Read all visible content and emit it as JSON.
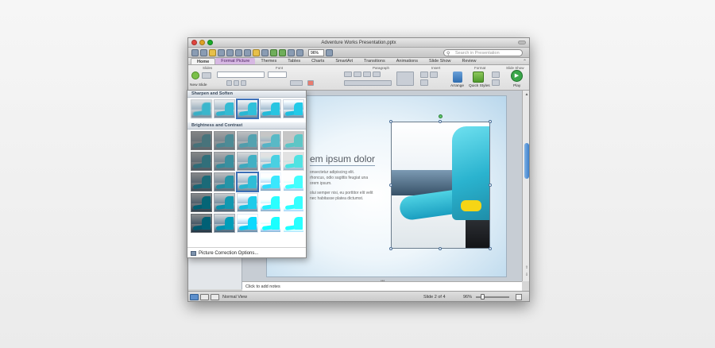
{
  "window": {
    "title": "Adventure Works Presentation.pptx",
    "search_placeholder": "Search in Presentation",
    "zoom_value": "96%"
  },
  "tabs": [
    "Home",
    "Format Picture",
    "Themes",
    "Tables",
    "Charts",
    "SmartArt",
    "Transitions",
    "Animations",
    "Slide Show",
    "Review"
  ],
  "ribbon": {
    "groups": [
      "Slides",
      "Font",
      "Paragraph",
      "Insert",
      "Format",
      "Slide Show"
    ],
    "new_slide_label": "New Slide",
    "arrange_label": "Arrange",
    "quick_styles_label": "Quick Styles",
    "play_label": "Play"
  },
  "gallery": {
    "section1": "Sharpen and Soften",
    "section2": "Brightness and Contrast",
    "footer": "Picture Correction Options..."
  },
  "slide": {
    "title_fragment": "em ipsum dolor",
    "body_lines": [
      "onsectetur adipiscing elit.",
      "rhoncus, odio sagittis feugiat una",
      "orem ipsum.",
      "olui semper nisi, eu porttitor elit velit",
      "nec habitasse platea dictumst."
    ]
  },
  "notes_placeholder": "Click to add notes",
  "status": {
    "view": "Normal View",
    "slide_info": "Slide 2 of 4",
    "zoom": "96%"
  },
  "colors": {
    "accent_tab": "#d7b8e3",
    "selection": "#3c6fb8",
    "jacket": "#2ab3cf"
  }
}
